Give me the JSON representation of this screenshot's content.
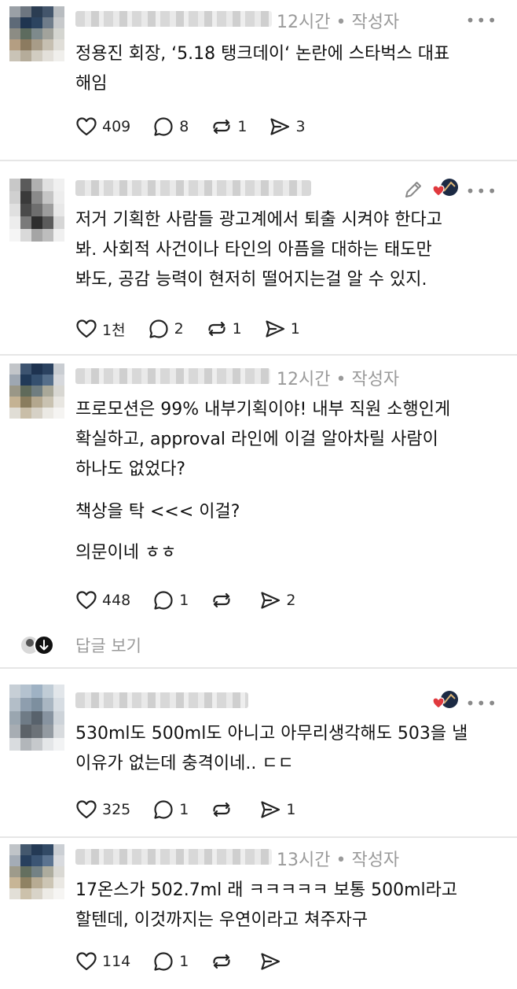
{
  "colors": {
    "text": "#111111",
    "meta": "#9a9a9a",
    "divider": "#e6e6e6",
    "heart": "#e0393e"
  },
  "posts": [
    {
      "time": "12시간",
      "tag": "• 작성자",
      "lines": [
        "정용진 회장, ‘5.18 탱크데이‘ 논란에 스타벅스 대표",
        "해임"
      ],
      "likes": "409",
      "comments": "8",
      "reposts": "1",
      "shares": "3"
    },
    {
      "lines": [
        "저거 기획한 사람들 광고계에서 퇴출 시켜야 한다고",
        "봐. 사회적 사건이나 타인의 아픔을 대하는 태도만",
        "봐도, 공감 능력이 현저히 떨어지는걸 알 수 있지."
      ],
      "likes": "1천",
      "comments": "2",
      "reposts": "1",
      "shares": "1"
    },
    {
      "time": "12시간",
      "tag": "• 작성자",
      "lines": [
        "프로모션은 99% 내부기획이야! 내부 직원 소행인게",
        "확실하고, approval 라인에 이걸 알아차릴 사람이",
        "하나도 없었다?"
      ],
      "para2": "책상을 탁 <<< 이걸?",
      "para3": "의문이네 ㅎㅎ",
      "likes": "448",
      "comments": "1",
      "reposts": "",
      "shares": "2",
      "replies_label": "답글 보기"
    },
    {
      "lines": [
        "530ml도 500ml도 아니고 아무리생각해도 503을 낼",
        "이유가 없는데 충격이네.. ㄷㄷ"
      ],
      "likes": "325",
      "comments": "1",
      "reposts": "",
      "shares": "1"
    },
    {
      "time": "13시간",
      "tag": "• 작성자",
      "lines": [
        "17온스가 502.7ml 래 ㅋㅋㅋㅋㅋ 보통 500ml라고",
        "할텐데, 이것까지는 우연이라고 쳐주자구"
      ],
      "likes": "114",
      "comments": "1",
      "reposts": "",
      "shares": ""
    }
  ],
  "icons": {
    "like": "heart-icon",
    "comment": "comment-bubble-icon",
    "repost": "repost-icon",
    "share": "send-icon",
    "more": "more-dots-icon",
    "edit": "pencil-icon"
  }
}
